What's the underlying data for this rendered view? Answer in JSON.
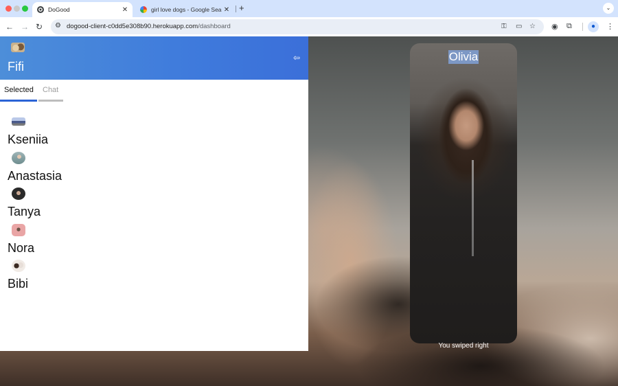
{
  "browser": {
    "tabs": [
      {
        "title": "DoGood",
        "active": true
      },
      {
        "title": "girl love dogs - Google Search",
        "active": false
      }
    ],
    "url_host": "dogood-client-c0dd5e308b90.herokuapp.com",
    "url_path": "/dashboard",
    "icons": {
      "back": "arrow-left-icon",
      "forward": "arrow-right-icon",
      "reload": "reload-icon",
      "site_info": "tune-icon",
      "passwords": "key-icon",
      "cast": "cast-icon",
      "bookmark": "star-icon",
      "screenshot": "camera-icon",
      "extensions": "puzzle-icon",
      "profile": "person-icon",
      "menu": "kebab-menu-icon"
    }
  },
  "sidebar": {
    "owner_name": "Fifi",
    "tabs": {
      "selected": "Selected",
      "chat": "Chat"
    },
    "matches": [
      {
        "name": "Kseniia"
      },
      {
        "name": "Anastasia"
      },
      {
        "name": "Tanya"
      },
      {
        "name": "Nora"
      },
      {
        "name": "Bibi"
      }
    ]
  },
  "card": {
    "name": "Olivia",
    "status": "You swiped right"
  },
  "colors": {
    "header_blue": "#3f7bdc",
    "tab_underline": "#2b63d6"
  }
}
